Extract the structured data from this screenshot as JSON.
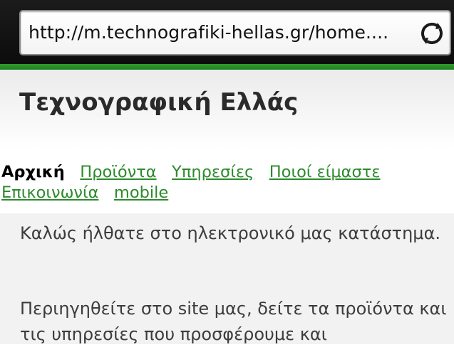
{
  "browser": {
    "url": "http://m.technografiki-hellas.gr/home....",
    "reload_icon": "reload-icon"
  },
  "site": {
    "title": "Τεχνογραφική Ελλάς"
  },
  "nav": {
    "current": "Αρχική",
    "items": [
      "Προϊόντα",
      "Υπηρεσίες",
      "Ποιοί είμαστε",
      "Επικοινωνία",
      "mobile"
    ]
  },
  "content": {
    "paragraph1": "Καλώς ήλθατε στο ηλεκτρονικό μας κατάστημα.",
    "paragraph2": "Περιηγηθείτε στο site μας, δείτε τα προϊόντα και τις υπηρεσίες που προσφέρουμε και"
  },
  "colors": {
    "accent_green": "#2c8a2c",
    "chrome_dark": "#111111"
  }
}
